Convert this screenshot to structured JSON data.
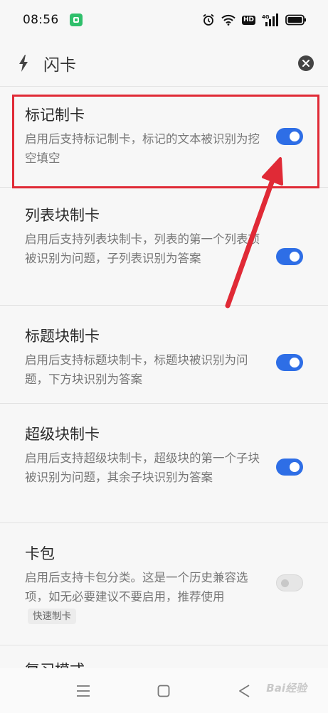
{
  "status_bar": {
    "time": "08:56",
    "hd_label": "HD",
    "network_label": "4G"
  },
  "header": {
    "title": "闪卡",
    "icons": [
      "bolt-icon",
      "close-icon"
    ]
  },
  "settings": [
    {
      "title": "标记制卡",
      "description": "启用后支持标记制卡，标记的文本被识别为挖空填空",
      "enabled": true
    },
    {
      "title": "列表块制卡",
      "description": "启用后支持列表块制卡，列表的第一个列表项被识别为问题，子列表识别为答案",
      "enabled": true
    },
    {
      "title": "标题块制卡",
      "description": "启用后支持标题块制卡，标题块被识别为问题，下方块识别为答案",
      "enabled": true
    },
    {
      "title": "超级块制卡",
      "description": "启用后支持超级块制卡，超级块的第一个子块被识别为问题，其余子块识别为答案",
      "enabled": true
    },
    {
      "title": "卡包",
      "description": "启用后支持卡包分类。这是一个历史兼容选项，如无必要建议不要启用，推荐使用",
      "tag": "快速制卡",
      "enabled": false
    },
    {
      "title": "复习模式"
    }
  ],
  "accent_colors": {
    "toggle_on": "#2e6ee6",
    "highlight": "#e02a36"
  },
  "nav_bar": {
    "icons": [
      "menu-icon",
      "home-icon",
      "back-icon"
    ]
  },
  "watermark": "Bai经验"
}
